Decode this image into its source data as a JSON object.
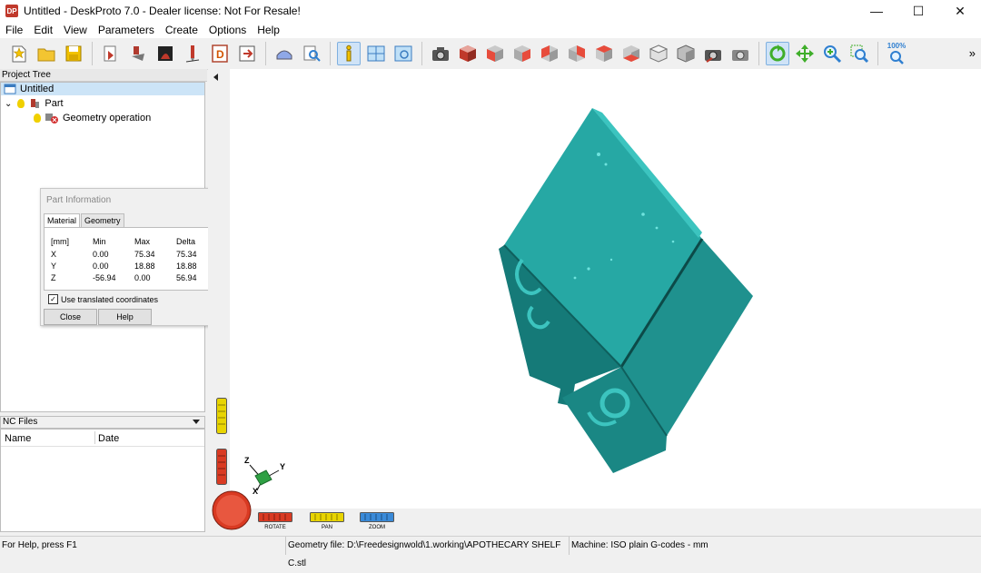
{
  "window": {
    "logo_text": "DP",
    "title": "Untitled - DeskProto 7.0 - Dealer license: Not For Resale!",
    "minimize": "—",
    "maximize": "☐",
    "close": "✕"
  },
  "menu": [
    "File",
    "Edit",
    "View",
    "Parameters",
    "Create",
    "Options",
    "Help"
  ],
  "toolbar": {
    "zoom_100": "100%",
    "more": "»"
  },
  "project_tree": {
    "header": "Project Tree",
    "items": [
      "Untitled",
      "Part",
      "Geometry operation"
    ]
  },
  "part_info": {
    "title": "Part Information",
    "tabs": [
      "Material",
      "Geometry"
    ],
    "columns": [
      "[mm]",
      "Min",
      "Max",
      "Delta"
    ],
    "rows": [
      [
        "X",
        "0.00",
        "75.34",
        "75.34"
      ],
      [
        "Y",
        "0.00",
        "18.88",
        "18.88"
      ],
      [
        "Z",
        "-56.94",
        "0.00",
        "56.94"
      ]
    ],
    "checkbox_label": "Use translated coordinates",
    "close_label": "Close",
    "help_label": "Help"
  },
  "nc_files": {
    "header": "NC Files",
    "columns": [
      "Name",
      "Date"
    ]
  },
  "viewport": {
    "axis_labels": [
      "Z",
      "Y",
      "X"
    ],
    "controls": [
      "ROTATE",
      "PAN",
      "ZOOM"
    ]
  },
  "status": {
    "help": "For Help, press F1",
    "geometry": "Geometry file: D:\\Freedesignwold\\1.working\\APOTHECARY SHELF C.stl",
    "machine": "Machine: ISO plain G-codes - mm"
  },
  "colors": {
    "model": "#26a8a4",
    "model_dark": "#157a78",
    "model_light": "#3cc4bf",
    "selection": "#cce4f7",
    "rotate": "#d93a22",
    "pan": "#e8d400",
    "zoom": "#3a8ad8"
  }
}
